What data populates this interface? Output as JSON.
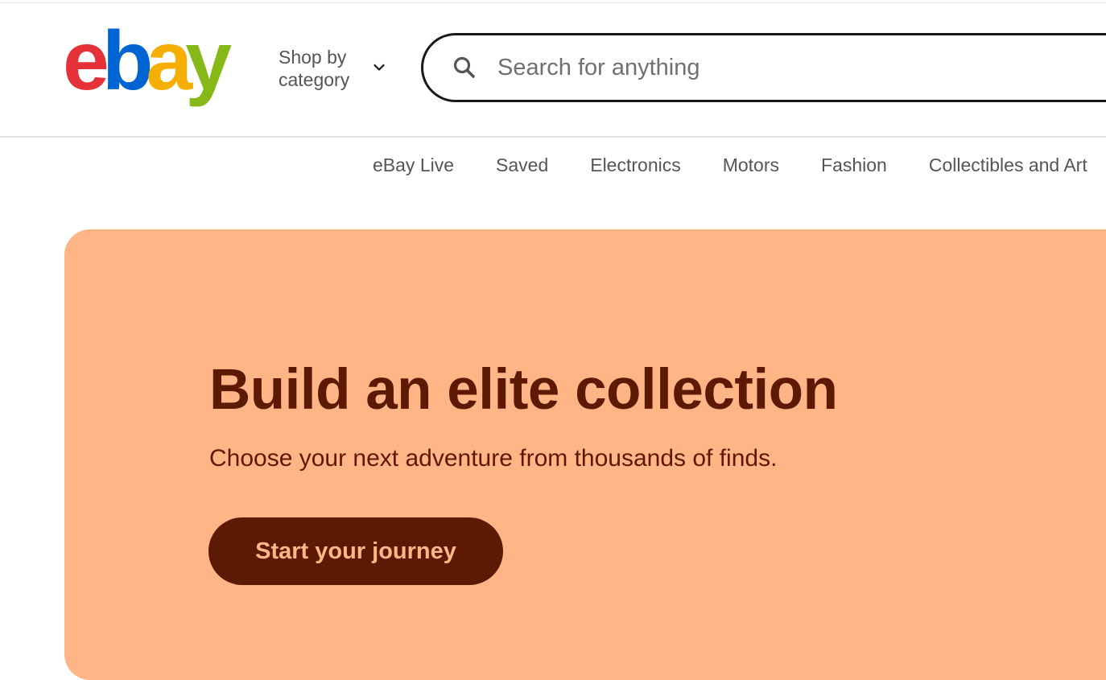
{
  "header": {
    "logo": {
      "letters": [
        {
          "char": "e",
          "color": "#e53238"
        },
        {
          "char": "b",
          "color": "#0064d2"
        },
        {
          "char": "a",
          "color": "#f5af02"
        },
        {
          "char": "y",
          "color": "#86b817"
        }
      ]
    },
    "shop_by_category": {
      "label": "Shop by category",
      "icon": "chevron-down-icon"
    },
    "search": {
      "placeholder": "Search for anything",
      "value": "",
      "icon": "search-icon"
    }
  },
  "nav": {
    "items": [
      {
        "label": "eBay Live"
      },
      {
        "label": "Saved"
      },
      {
        "label": "Electronics"
      },
      {
        "label": "Motors"
      },
      {
        "label": "Fashion"
      },
      {
        "label": "Collectibles and Art"
      }
    ]
  },
  "hero": {
    "title": "Build an elite collection",
    "subtitle": "Choose your next adventure from thousands of finds.",
    "cta_label": "Start your journey",
    "background_color": "#ffb585",
    "text_color": "#5c1a05"
  }
}
